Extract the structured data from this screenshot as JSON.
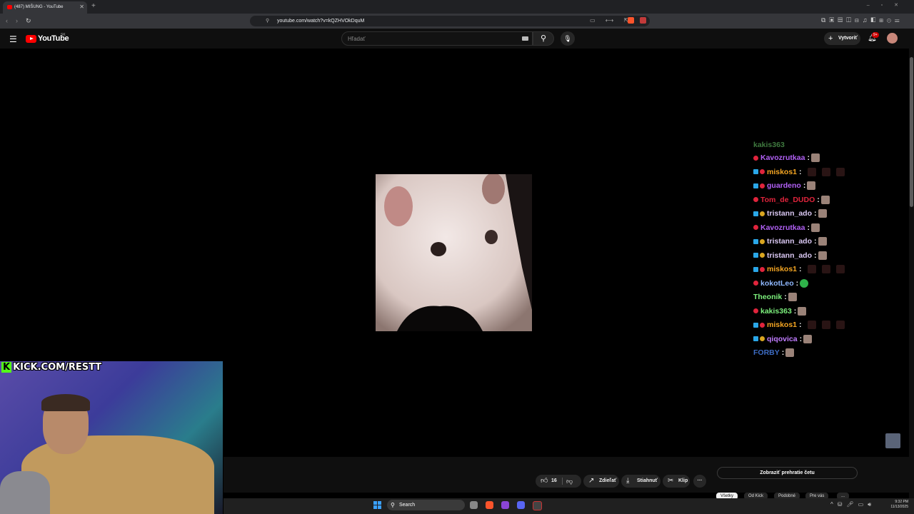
{
  "browser": {
    "tab_title": "(487) MIŠUNG - YouTube",
    "tab_close": "✕",
    "new_tab": "+",
    "url": "youtube.com/watch?v=kQZHVOkDquM",
    "window_controls": "–▫✕"
  },
  "youtube": {
    "logo_text": "YouTube",
    "country_code": "SK",
    "search_placeholder": "Hľadať",
    "create_label": "Vytvoriť",
    "notification_count": "9+"
  },
  "overlay": {
    "kick_text": "KICK.COM/RESTT",
    "kick_k": "K"
  },
  "chat": {
    "partial_top": "kakis363",
    "messages": [
      {
        "user": "Kavozrutkaa",
        "color": "#b160f5",
        "badges": [
          "red"
        ],
        "emotes": 1,
        "dim": 0
      },
      {
        "user": "miskos1",
        "color": "#f5a623",
        "badges": [
          "blue",
          "red"
        ],
        "emotes": 0,
        "dim": 3
      },
      {
        "user": "guardeno",
        "color": "#b160f5",
        "badges": [
          "blue",
          "red"
        ],
        "emotes": 1,
        "dim": 0
      },
      {
        "user": "Tom_de_DUDO",
        "color": "#e0243c",
        "badges": [
          "red"
        ],
        "emotes": 1,
        "dim": 0
      },
      {
        "user": "tristann_ado",
        "color": "#d9c7f2",
        "badges": [
          "blue",
          "gold"
        ],
        "emotes": 1,
        "dim": 0
      },
      {
        "user": "Kavozrutkaa",
        "color": "#b160f5",
        "badges": [
          "red"
        ],
        "emotes": 1,
        "dim": 0
      },
      {
        "user": "tristann_ado",
        "color": "#d9c7f2",
        "badges": [
          "blue",
          "gold"
        ],
        "emotes": 1,
        "dim": 0
      },
      {
        "user": "tristann_ado",
        "color": "#d9c7f2",
        "badges": [
          "blue",
          "gold"
        ],
        "emotes": 1,
        "dim": 0
      },
      {
        "user": "miskos1",
        "color": "#f5a623",
        "badges": [
          "blue",
          "red"
        ],
        "emotes": 0,
        "dim": 3
      },
      {
        "user": "kokotLeo",
        "color": "#8fb8ff",
        "badges": [
          "red"
        ],
        "emotes": 0,
        "green": 1,
        "dim": 0
      },
      {
        "user": "Theonik",
        "color": "#7cf07c",
        "badges": [],
        "emotes": 1,
        "dim": 0
      },
      {
        "user": "kakis363",
        "color": "#7cf07c",
        "badges": [
          "red"
        ],
        "emotes": 1,
        "dim": 0
      },
      {
        "user": "miskos1",
        "color": "#f5a623",
        "badges": [
          "blue",
          "red"
        ],
        "emotes": 0,
        "dim": 3
      },
      {
        "user": "qiqovica",
        "color": "#c07cff",
        "badges": [
          "blue",
          "gold"
        ],
        "emotes": 1,
        "dim": 0
      },
      {
        "user": "FORBY",
        "color": "#3d6cc4",
        "badges": [],
        "emotes": 1,
        "dim": 0
      }
    ],
    "separator": ":"
  },
  "actions": {
    "like_count": "16",
    "share_label": "Zdieľať",
    "download_label": "Stiahnuť",
    "clip_label": "Klip",
    "more_label": "···",
    "replay_chat_label": "Zobraziť prehratie četu"
  },
  "chips": [
    "Všetky",
    "Od Kick",
    "Podobné",
    "Pre vás",
    "..."
  ],
  "taskbar": {
    "search_label": "Search",
    "time": "9:32 PM",
    "date": "11/13/2025"
  },
  "icons": {
    "menu": "menu-icon",
    "search": "search-icon",
    "mic": "mic-icon",
    "bell": "bell-icon",
    "like": "thumbs-up-icon",
    "dislike": "thumbs-down-icon",
    "share": "share-icon",
    "download": "download-icon",
    "clip": "scissors-icon"
  },
  "colors": {
    "youtube_red": "#ff0000",
    "kick_green": "#53fc18",
    "yt_background": "#0f0f0f"
  }
}
